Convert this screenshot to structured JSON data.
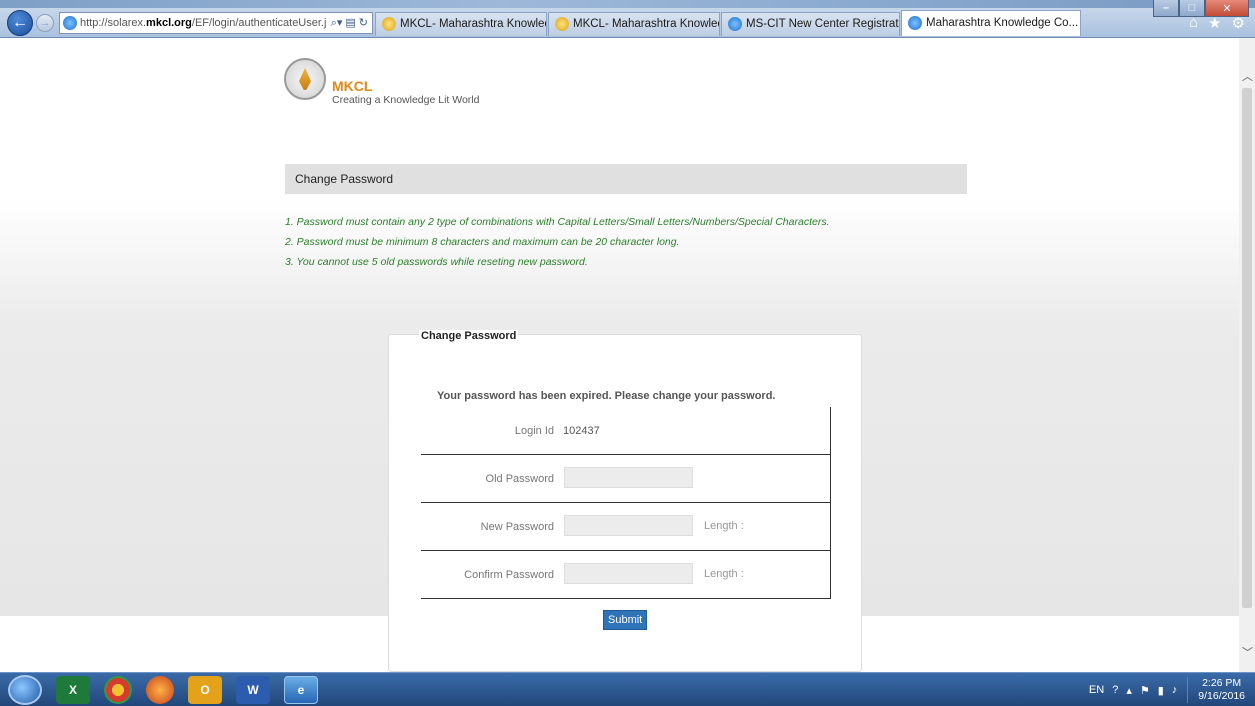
{
  "browser": {
    "url_prefix": "http://solarex.",
    "url_domain": "mkcl.org",
    "url_suffix": "/EF/login/authenticateUser.j",
    "tabs": [
      {
        "label": "MKCL- Maharashtra Knowledg...",
        "icon": "mkcl-icon"
      },
      {
        "label": "MKCL- Maharashtra Knowledg...",
        "icon": "mkcl-icon"
      },
      {
        "label": "MS-CIT New Center Registration",
        "icon": "ie-icon"
      },
      {
        "label": "Maharashtra Knowledge Co...",
        "icon": "ie-icon",
        "active": true
      }
    ]
  },
  "header": {
    "logo_title": "MKCL",
    "logo_subtitle": "Creating a Knowledge Lit World"
  },
  "section_title": "Change Password",
  "rules": [
    "1.  Password must contain any 2 type of combinations with Capital Letters/Small Letters/Numbers/Special Characters.",
    "2.  Password must be minimum 8 characters and maximum can be 20 character long.",
    "3.  You cannot use 5 old passwords while reseting new password."
  ],
  "panel": {
    "legend": "Change Password",
    "expired_message": "Your password has been expired. Please change your password.",
    "login_id_label": "Login Id",
    "login_id_value": "102437",
    "old_password_label": "Old Password",
    "new_password_label": "New Password",
    "confirm_password_label": "Confirm Password",
    "length_label": "Length :",
    "submit_label": "Submit"
  },
  "taskbar": {
    "language": "EN",
    "time": "2:26 PM",
    "date": "9/16/2016"
  }
}
